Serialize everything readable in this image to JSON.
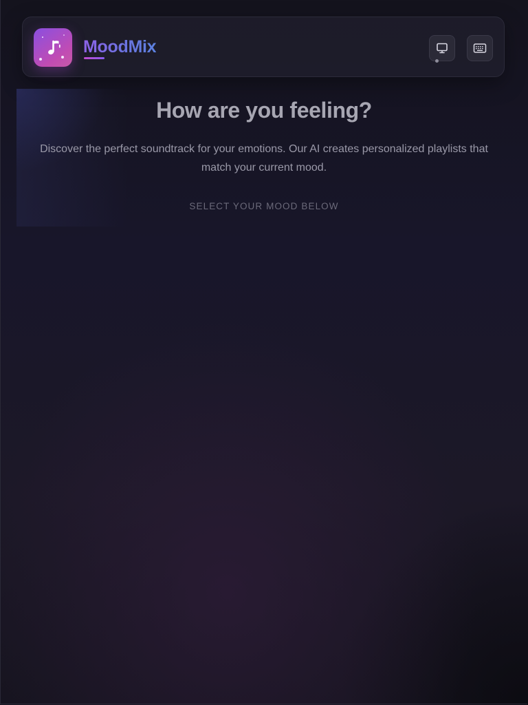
{
  "app": {
    "name": "MoodMix",
    "logo_icon": "music-note-icon"
  },
  "header": {
    "buttons": [
      {
        "icon": "monitor-icon"
      },
      {
        "icon": "keyboard-icon"
      }
    ]
  },
  "hero": {
    "title": "How are you feeling?",
    "subtitle": "Discover the perfect soundtrack for your emotions. Our AI creates personalized playlists that match your current mood.",
    "prompt": "SELECT YOUR MOOD BELOW"
  },
  "colors": {
    "background": "#18162a",
    "brand_gradient_start": "#8e63e8",
    "brand_gradient_end": "#5c82e0",
    "logo_gradient_start": "#8a4fe0",
    "logo_gradient_end": "#c14cb3",
    "title_text": "#a7a6b2",
    "body_text": "#9a99a8",
    "muted_text": "#6b6a7a"
  }
}
